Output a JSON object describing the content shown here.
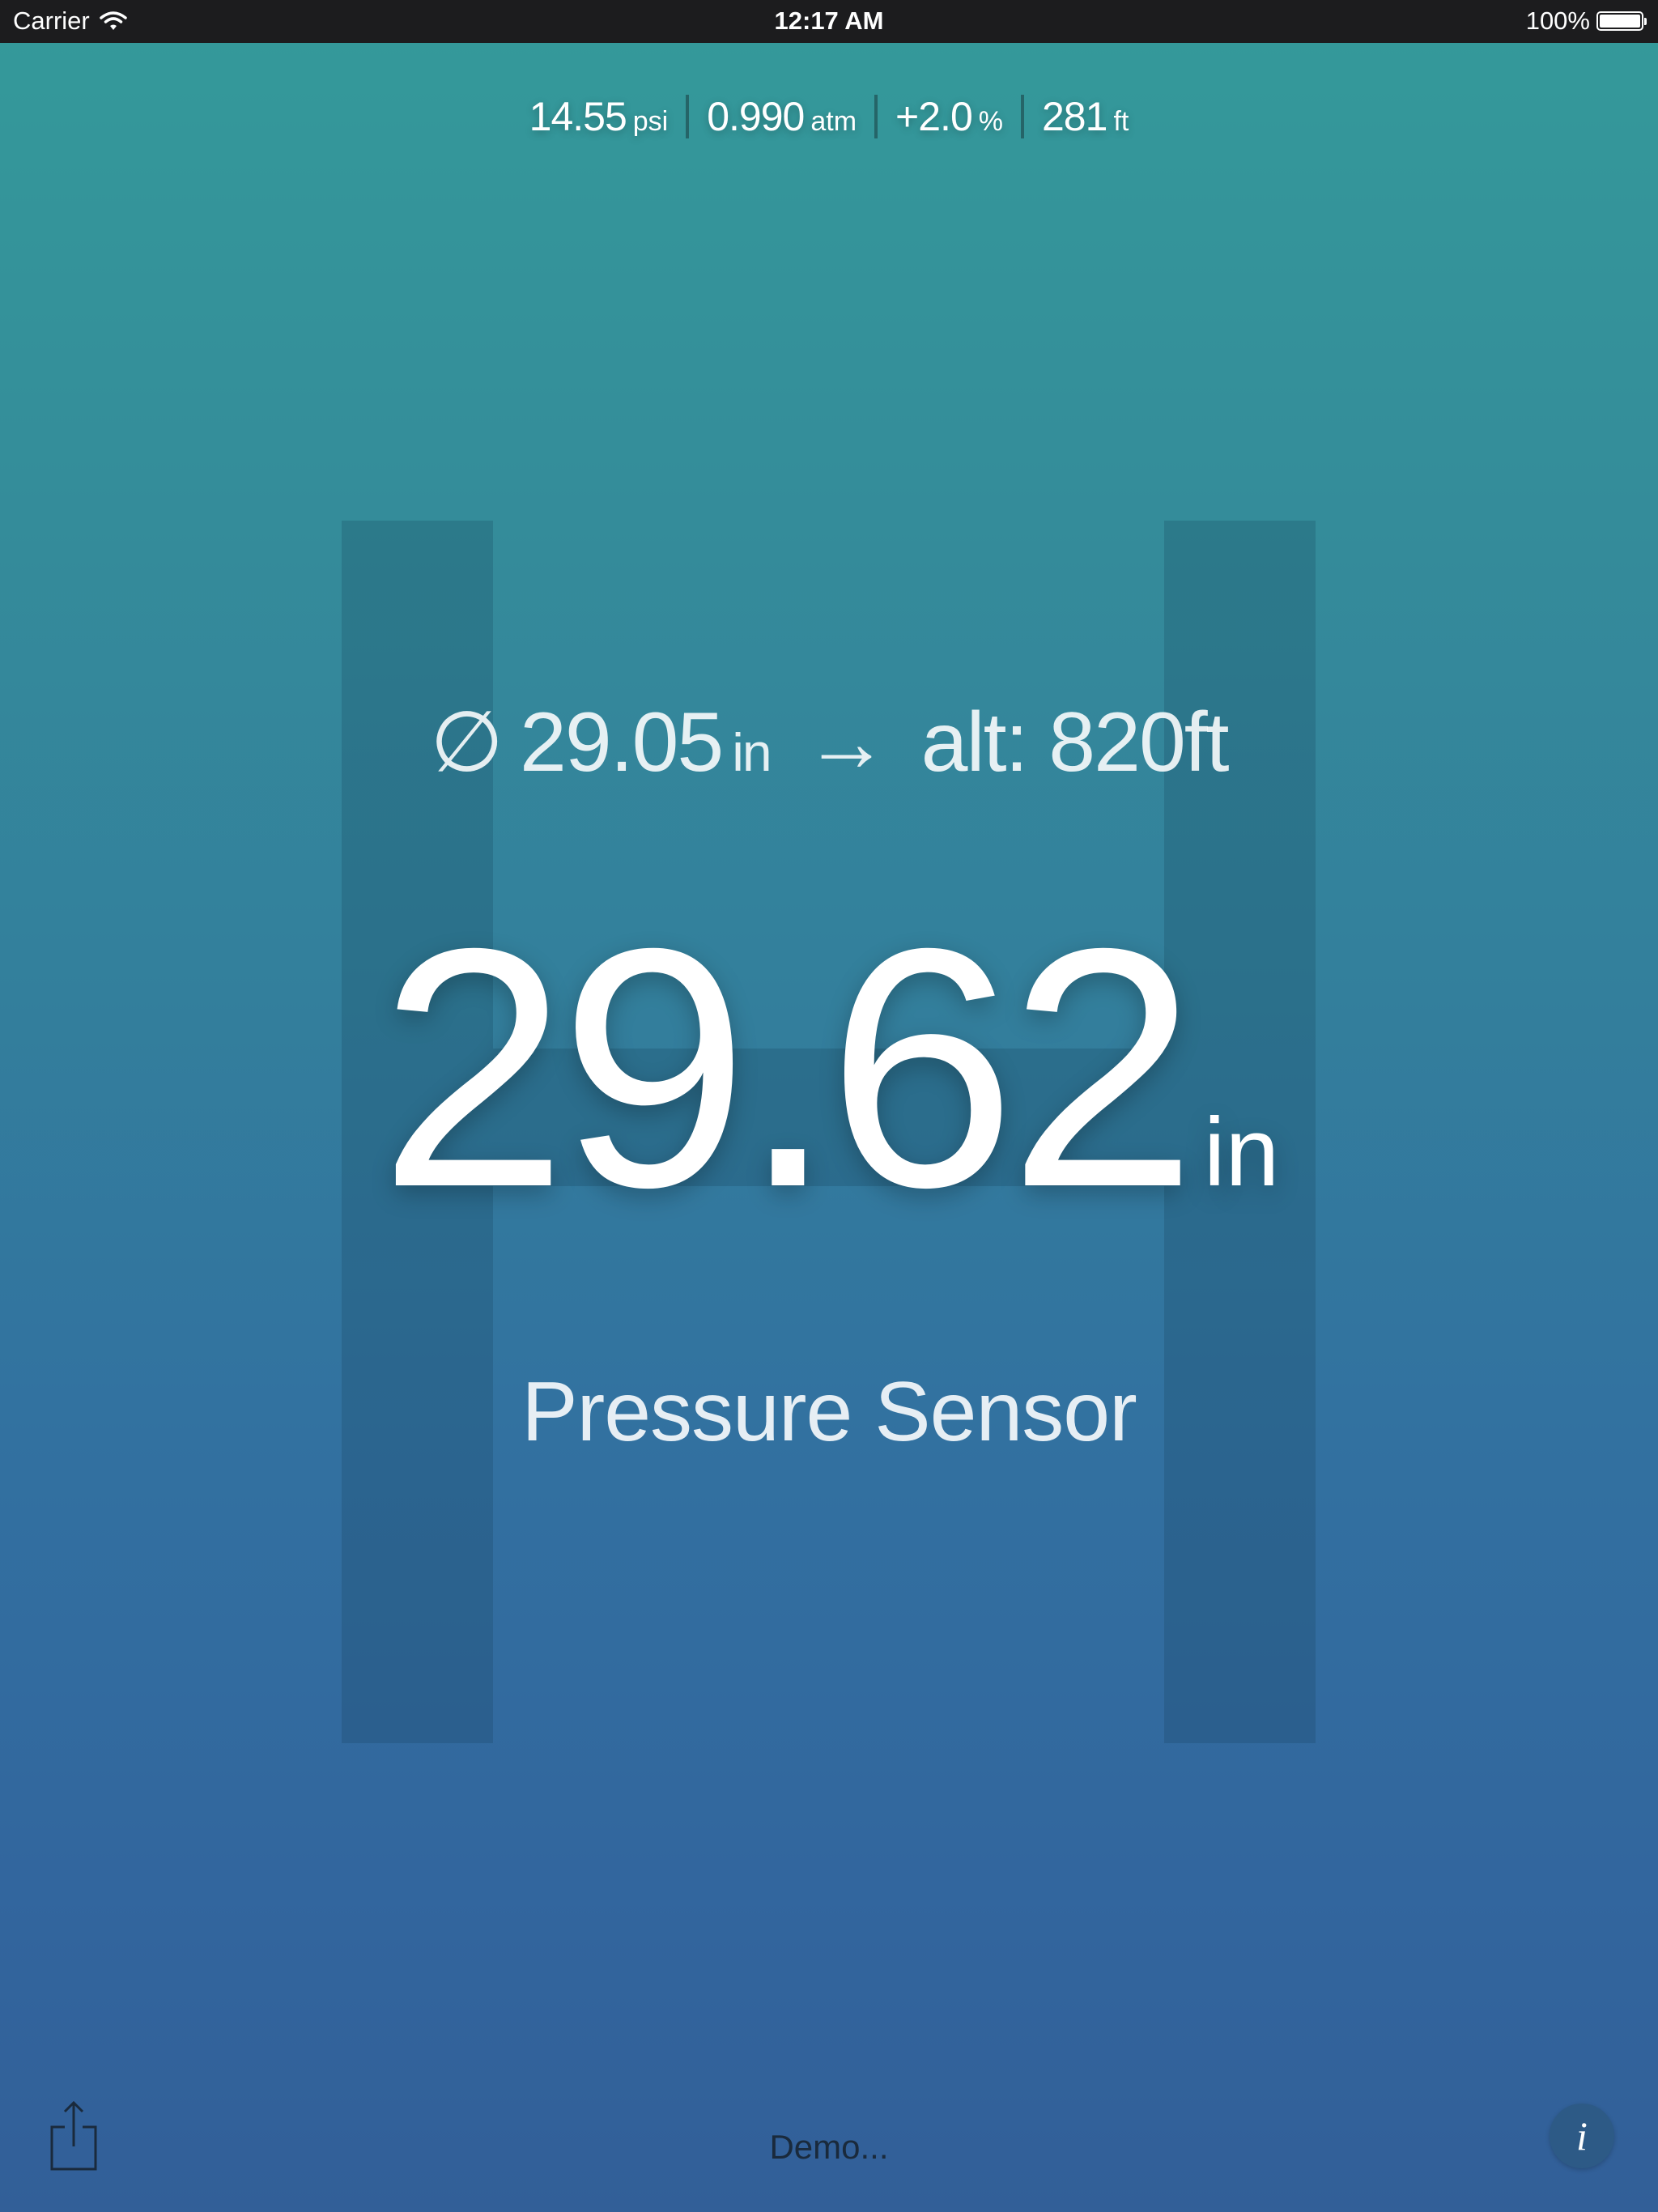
{
  "status_bar": {
    "carrier": "Carrier",
    "time": "12:17 AM",
    "battery": "100%",
    "battery_level": 1.0
  },
  "metrics": [
    {
      "value": "14.55",
      "unit": "psi"
    },
    {
      "value": "0.990",
      "unit": "atm"
    },
    {
      "value": "+2.0",
      "unit": "%"
    },
    {
      "value": "281",
      "unit": "ft"
    }
  ],
  "average": {
    "symbol": "∅",
    "value": "29.05",
    "unit": "in",
    "arrow": "→",
    "altitude": "alt: 820ft"
  },
  "reading": {
    "value": "29.62",
    "unit": "in"
  },
  "sensor_label": "Pressure Sensor",
  "bottom": {
    "demo_label": "Demo...",
    "info_label": "i"
  },
  "colors": {
    "gradient_top": "#349a9a",
    "gradient_bottom": "#325f98",
    "status_bar": "#1c1c1e"
  },
  "icons": {
    "wifi": "wifi-icon",
    "battery": "battery-icon",
    "share": "share-icon",
    "info": "info-icon"
  }
}
